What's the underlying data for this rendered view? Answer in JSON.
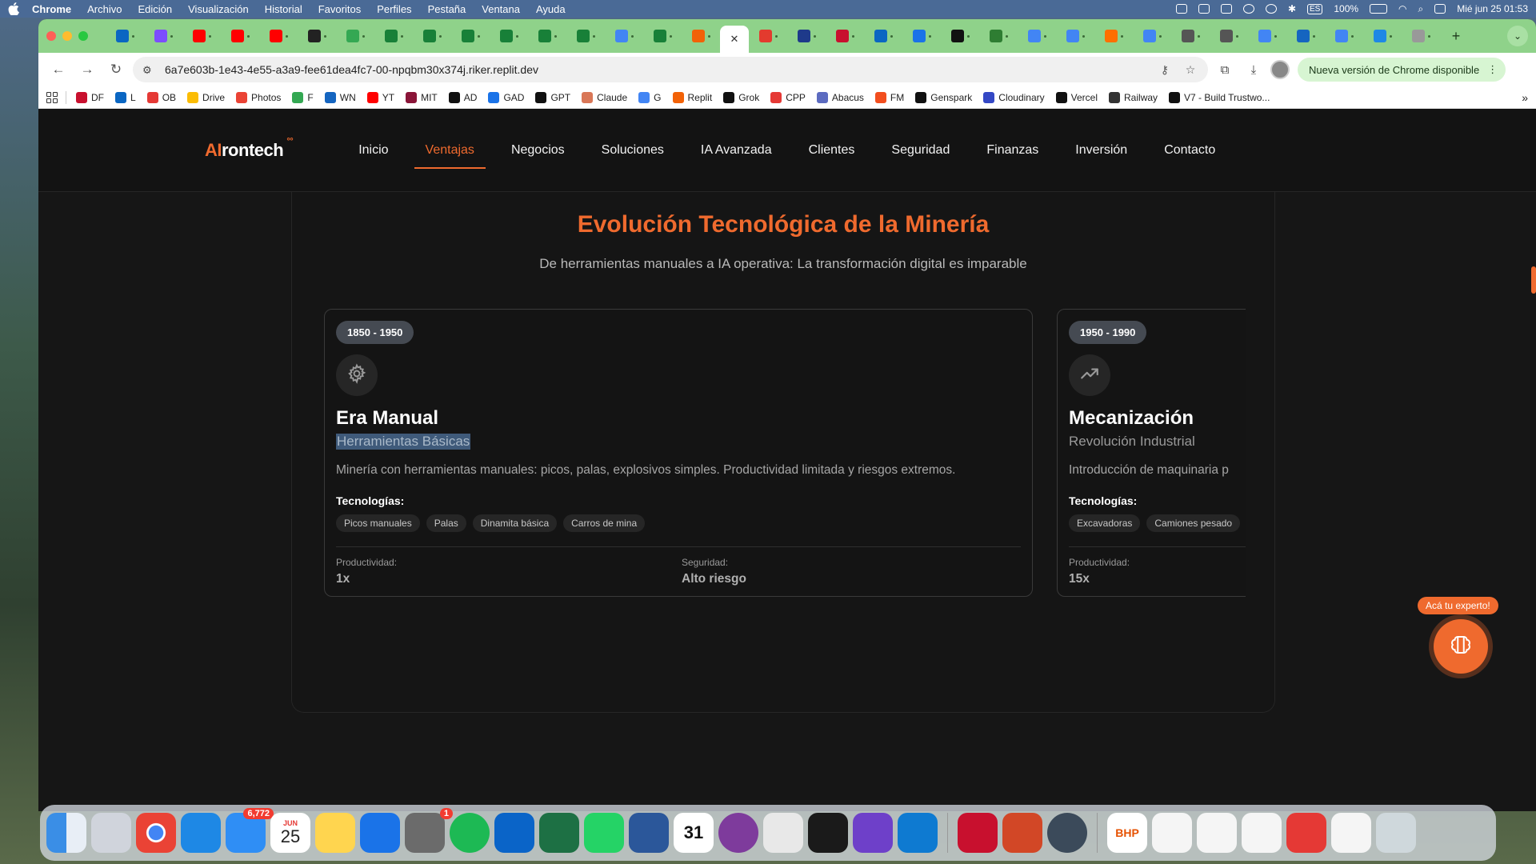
{
  "menubar": {
    "app": "Chrome",
    "items": [
      "Archivo",
      "Edición",
      "Visualización",
      "Historial",
      "Favoritos",
      "Perfiles",
      "Pestaña",
      "Ventana",
      "Ayuda"
    ],
    "battery": "100%",
    "lang": "ES",
    "clock": "Mié jun 25  01:53"
  },
  "browser": {
    "url": "6a7e603b-1e43-4e55-a3a9-fee61dea4fc7-00-npqbm30x374j.riker.replit.dev",
    "update_label": "Nueva versión de Chrome disponible",
    "tab_favicon_colors": [
      "#0a66c2",
      "#7c4dff",
      "#ff0000",
      "#ff0000",
      "#ff0000",
      "#222222",
      "#34a853",
      "#188038",
      "#188038",
      "#188038",
      "#188038",
      "#188038",
      "#188038",
      "#4285f4",
      "#188038",
      "#f26207"
    ],
    "tab_favicon_colors_right": [
      "#e33b2e",
      "#1e3a8a",
      "#c8102e",
      "#0a66c2",
      "#1a73e8",
      "#111111",
      "#2e7d32",
      "#4285f4",
      "#4285f4",
      "#ff6f00",
      "#4285f4",
      "#555555",
      "#555555",
      "#4285f4",
      "#1565c0",
      "#4285f4",
      "#1e88e5",
      "#999999"
    ]
  },
  "bookmarks": [
    {
      "label": "DF",
      "color": "#c8102e"
    },
    {
      "label": "L",
      "color": "#0a66c2"
    },
    {
      "label": "OB",
      "color": "#e53935"
    },
    {
      "label": "Drive",
      "color": "#fbbc04"
    },
    {
      "label": "Photos",
      "color": "#ea4335"
    },
    {
      "label": "F",
      "color": "#34a853"
    },
    {
      "label": "WN",
      "color": "#1565c0"
    },
    {
      "label": "YT",
      "color": "#ff0000"
    },
    {
      "label": "MIT",
      "color": "#8a1538"
    },
    {
      "label": "AD",
      "color": "#111111"
    },
    {
      "label": "GAD",
      "color": "#1a73e8"
    },
    {
      "label": "GPT",
      "color": "#111111"
    },
    {
      "label": "Claude",
      "color": "#d97757"
    },
    {
      "label": "G",
      "color": "#4285f4"
    },
    {
      "label": "Replit",
      "color": "#f26207"
    },
    {
      "label": "Grok",
      "color": "#111111"
    },
    {
      "label": "CPP",
      "color": "#e53935"
    },
    {
      "label": "Abacus",
      "color": "#5c6bc0"
    },
    {
      "label": "FM",
      "color": "#f24e1e"
    },
    {
      "label": "Genspark",
      "color": "#111111"
    },
    {
      "label": "Cloudinary",
      "color": "#3448c5"
    },
    {
      "label": "Vercel",
      "color": "#111111"
    },
    {
      "label": "Railway",
      "color": "#333333"
    },
    {
      "label": "V7 - Build Trustwo...",
      "color": "#111111"
    }
  ],
  "site": {
    "logo_ai": "AI",
    "logo_rest": "rontech",
    "logo_sup": "°°",
    "nav": [
      "Inicio",
      "Ventajas",
      "Negocios",
      "Soluciones",
      "IA Avanzada",
      "Clientes",
      "Seguridad",
      "Finanzas",
      "Inversión",
      "Contacto"
    ],
    "active_nav": "Ventajas",
    "section_title": "Evolución Tecnológica de la Minería",
    "section_subtitle": "De herramientas manuales a IA operativa: La transformación digital es imparable",
    "expert_label": "Acá tu experto!",
    "accent": "#ef6a2e"
  },
  "timeline_cards": [
    {
      "period": "1850 - 1950",
      "icon": "gear-icon",
      "title": "Era Manual",
      "subtitle": "Herramientas Básicas",
      "description": "Minería con herramientas manuales: picos, palas, explosivos simples. Productividad limitada y riesgos extremos.",
      "tech_label": "Tecnologías:",
      "techs": [
        "Picos manuales",
        "Palas",
        "Dinamita básica",
        "Carros de mina"
      ],
      "productivity_label": "Productividad:",
      "productivity": "1x",
      "safety_label": "Seguridad:",
      "safety": "Alto riesgo"
    },
    {
      "period": "1950 - 1990",
      "icon": "trending-up-icon",
      "title": "Mecanización",
      "subtitle": "Revolución Industrial",
      "description": "Introducción de maquinaria p",
      "tech_label": "Tecnologías:",
      "techs": [
        "Excavadoras",
        "Camiones pesado"
      ],
      "productivity_label": "Productividad:",
      "productivity": "15x"
    }
  ],
  "dock": {
    "mail_badge": "6,772",
    "calendar_month": "JUN",
    "calendar_day": "25",
    "settings_badge": "1",
    "day_31": "31",
    "bhp_label": "BHP"
  }
}
